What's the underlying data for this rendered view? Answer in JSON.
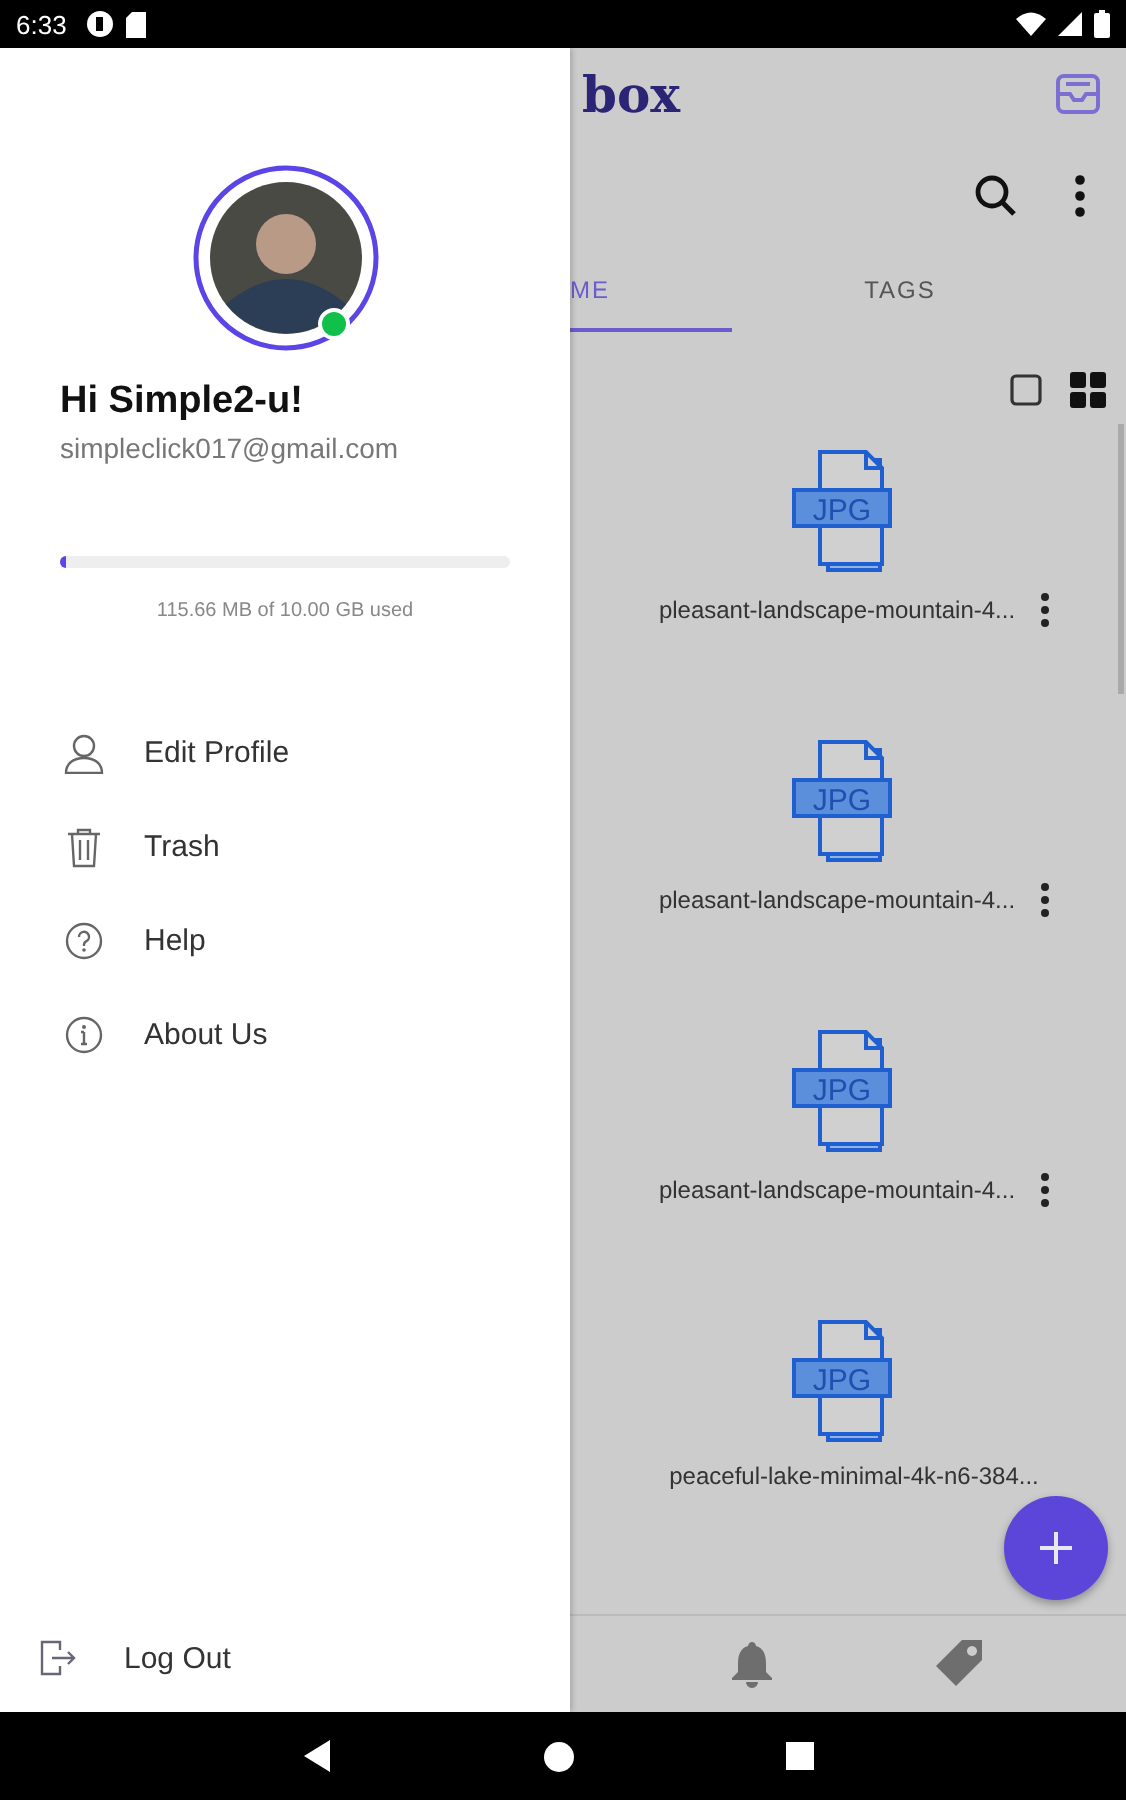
{
  "status_bar": {
    "time": "6:33"
  },
  "app": {
    "logo": "box",
    "tabs": [
      {
        "label": "ME",
        "selected": true
      },
      {
        "label": "TAGS",
        "selected": false
      }
    ],
    "view_modes": [
      {
        "kind": "single"
      },
      {
        "kind": "grid"
      }
    ],
    "files": [
      {
        "name": "pleasant-landscape-mountain-4...",
        "badge": "JPG",
        "more_button": true
      },
      {
        "name": "pleasant-landscape-mountain-4...",
        "badge": "JPG",
        "more_button": true
      },
      {
        "name": "pleasant-landscape-mountain-4...",
        "badge": "JPG",
        "more_button": true
      },
      {
        "name": "peaceful-lake-minimal-4k-n6-384...",
        "badge": "JPG",
        "more_button": false
      }
    ],
    "bottom_nav": [
      {
        "kind": "bell"
      },
      {
        "kind": "tag"
      }
    ]
  },
  "drawer": {
    "greeting": "Hi Simple2-u!",
    "email": "simpleclick017@gmail.com",
    "online": true,
    "storage": {
      "level": 0.012,
      "caption": "115.66 MB of 10.00 GB used"
    },
    "menu": [
      {
        "label": "Edit Profile",
        "kind": "profile"
      },
      {
        "label": "Trash",
        "kind": "trash"
      },
      {
        "label": "Help",
        "kind": "help"
      },
      {
        "label": "About Us",
        "kind": "info"
      }
    ],
    "logout": "Log Out"
  }
}
